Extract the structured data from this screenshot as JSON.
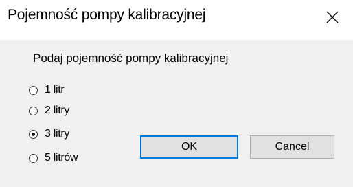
{
  "window": {
    "title": "Pojemność pompy kalibracyjnej",
    "close_icon": "close-icon"
  },
  "form": {
    "prompt": "Podaj pojemność pompy kalibracyjnej",
    "options": [
      {
        "label": "1 litr",
        "checked": false
      },
      {
        "label": "2 litry",
        "checked": false
      },
      {
        "label": "3 litry",
        "checked": true
      },
      {
        "label": "5 litrów",
        "checked": false
      }
    ],
    "selected": "3 litry"
  },
  "buttons": {
    "ok_label": "OK",
    "cancel_label": "Cancel"
  },
  "colors": {
    "titlebar": "#ffffff",
    "client_area": "#f0f0f0",
    "button_face": "#e1e1e1",
    "default_button_border": "#0078d7"
  }
}
